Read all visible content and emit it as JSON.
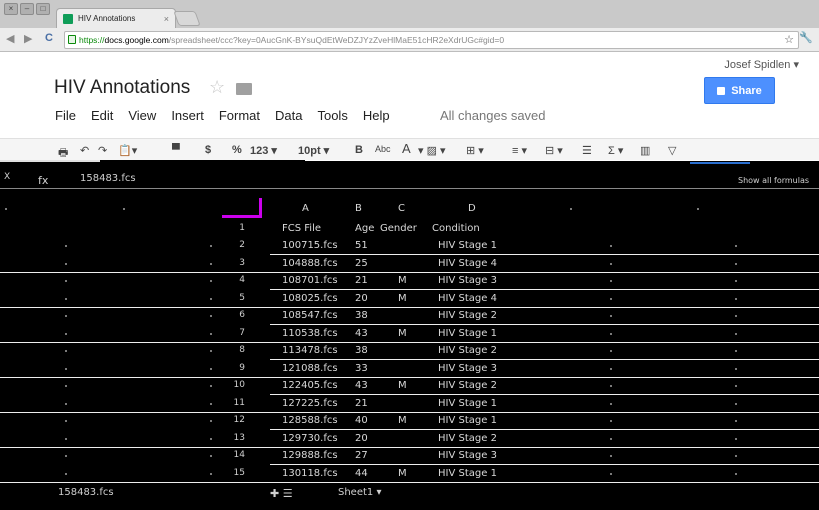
{
  "browser": {
    "tab_title": "HIV Annotations",
    "url_https": "https://",
    "url_host": "docs.google.com",
    "url_path": "/spreadsheet/ccc?key=0AucGnK-BYsuQdEtWeDZJYzZveHlMaE51cHR2eXdrUGc#gid=0"
  },
  "doc": {
    "title": "HIV Annotations",
    "user": "Josef Spidlen ▾",
    "share_label": "Share",
    "status": "All changes saved",
    "menu": [
      "File",
      "Edit",
      "View",
      "Insert",
      "Format",
      "Data",
      "Tools",
      "Help"
    ]
  },
  "format_bar": {
    "currency": "$",
    "percent": "%",
    "number_format": "123 ▾",
    "font_size": "10pt ▾",
    "bold": "B",
    "strike": "Abc",
    "text_color": "A"
  },
  "formula_bar": {
    "cell_ref": "X",
    "formula": "158483.fcs"
  },
  "sheet": {
    "column_headers": [
      "A",
      "B",
      "C",
      "D"
    ],
    "header_row": {
      "num": "1",
      "cells": [
        "FCS File",
        "Age",
        "Gender",
        "Condition"
      ]
    },
    "rows": [
      {
        "num": "2",
        "cells": [
          "100715.fcs",
          "51",
          "",
          "HIV Stage 1"
        ]
      },
      {
        "num": "3",
        "cells": [
          "104888.fcs",
          "25",
          "",
          "HIV Stage 4"
        ]
      },
      {
        "num": "4",
        "cells": [
          "108701.fcs",
          "21",
          "M",
          "HIV Stage 3"
        ]
      },
      {
        "num": "5",
        "cells": [
          "108025.fcs",
          "20",
          "M",
          "HIV Stage 4"
        ]
      },
      {
        "num": "6",
        "cells": [
          "108547.fcs",
          "38",
          "",
          "HIV Stage 2"
        ]
      },
      {
        "num": "7",
        "cells": [
          "110538.fcs",
          "43",
          "M",
          "HIV Stage 1"
        ]
      },
      {
        "num": "8",
        "cells": [
          "113478.fcs",
          "38",
          "",
          "HIV Stage 2"
        ]
      },
      {
        "num": "9",
        "cells": [
          "121088.fcs",
          "33",
          "",
          "HIV Stage 3"
        ]
      },
      {
        "num": "10",
        "cells": [
          "122405.fcs",
          "43",
          "M",
          "HIV Stage 2"
        ]
      },
      {
        "num": "11",
        "cells": [
          "127225.fcs",
          "21",
          "",
          "HIV Stage 1"
        ]
      },
      {
        "num": "12",
        "cells": [
          "128588.fcs",
          "40",
          "M",
          "HIV Stage 1"
        ]
      },
      {
        "num": "13",
        "cells": [
          "129730.fcs",
          "20",
          "",
          "HIV Stage 2"
        ]
      },
      {
        "num": "14",
        "cells": [
          "129888.fcs",
          "27",
          "",
          "HIV Stage 3"
        ]
      },
      {
        "num": "15",
        "cells": [
          "130118.fcs",
          "44",
          "M",
          "HIV Stage 1"
        ]
      }
    ],
    "show_all_formulas": "Show all formulas",
    "bottom_cell": "158483.fcs",
    "sheet_tab": "Sheet1 ▾"
  },
  "colors": {
    "share": "#4d90fe",
    "https": "#0a8a0a",
    "sheets_green": "#0f9d58"
  }
}
